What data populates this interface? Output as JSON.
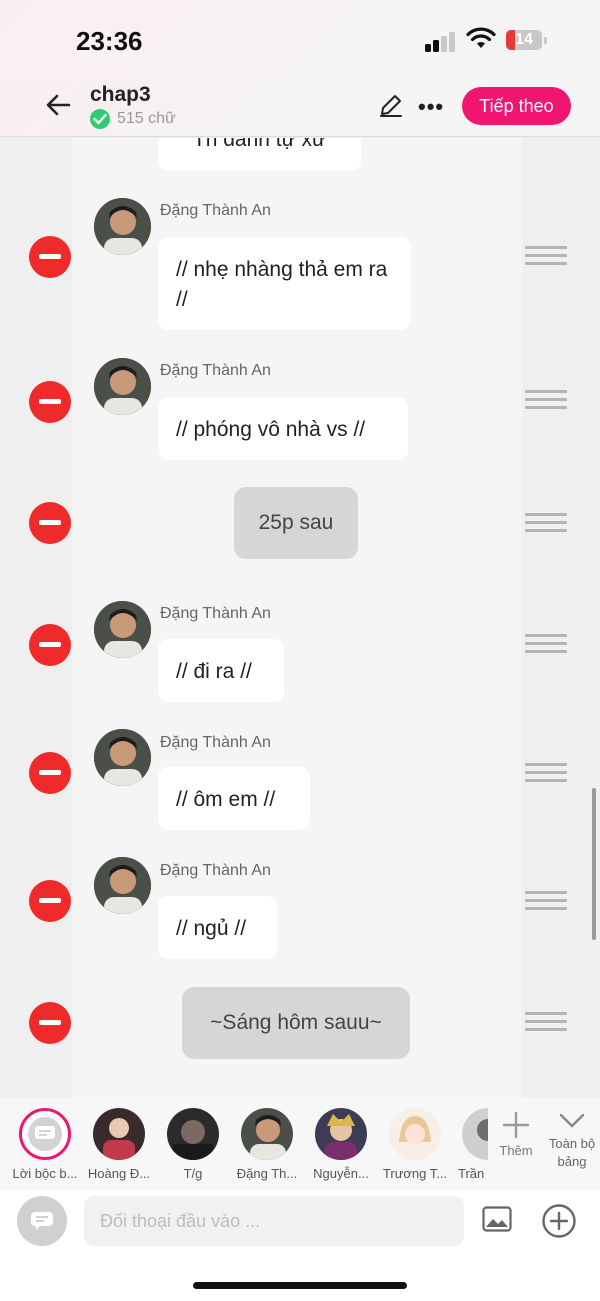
{
  "status_bar": {
    "time": "23:36",
    "battery": "14"
  },
  "header": {
    "title": "chap3",
    "word_count": "515 chữ",
    "next_label": "Tiếp theo"
  },
  "messages": [
    {
      "type": "partial",
      "text": "“Tn danh tự xư”"
    },
    {
      "type": "dialog",
      "speaker": "Đặng Thành An",
      "text": "// nhẹ nhàng thả em ra //"
    },
    {
      "type": "dialog",
      "speaker": "Đặng Thành An",
      "text": "// phóng vô nhà vs //"
    },
    {
      "type": "narration",
      "text": "25p sau"
    },
    {
      "type": "dialog",
      "speaker": "Đặng Thành An",
      "text": "// đi ra //"
    },
    {
      "type": "dialog",
      "speaker": "Đặng Thành An",
      "text": "// ôm em //"
    },
    {
      "type": "dialog",
      "speaker": "Đặng Thành An",
      "text": "// ngủ //"
    },
    {
      "type": "narration",
      "text": "~Sáng hôm sauu~"
    }
  ],
  "characters": [
    {
      "label": "Lời bộc b...",
      "icon": "narration-icon"
    },
    {
      "label": "Hoàng Đ..."
    },
    {
      "label": "T/g"
    },
    {
      "label": "Đặng Th..."
    },
    {
      "label": "Nguyễn..."
    },
    {
      "label": "Trương T..."
    },
    {
      "label": "Trần"
    }
  ],
  "add_label": "Thêm",
  "all_label": "Toàn bộ bảng",
  "input": {
    "placeholder": "Đối thoại đầu vào ..."
  },
  "colors": {
    "accent": "#f0166f",
    "delete": "#ee2a2a",
    "verified": "#2ecc71"
  }
}
